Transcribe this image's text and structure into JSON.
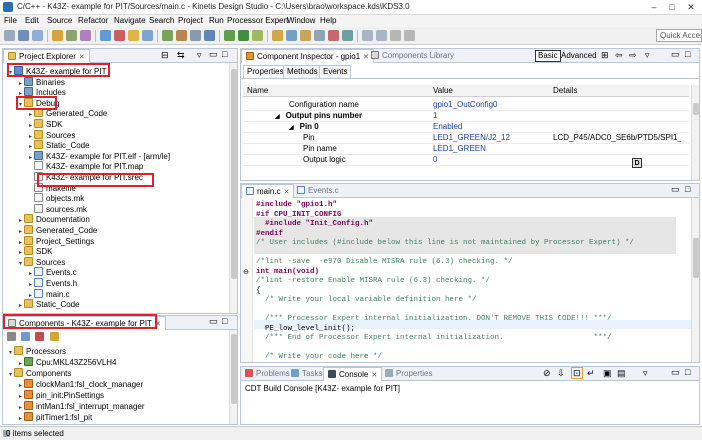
{
  "window": {
    "title": "C/C++ - K43Z- example for PIT/Sources/main.c - Kinetis Design Studio - C:\\Users\\brao\\workspace.kds\\KDS3.0",
    "buttons": [
      "–",
      "□",
      "✕"
    ]
  },
  "menu": [
    "File",
    "Edit",
    "Source",
    "Refactor",
    "Navigate",
    "Search",
    "Project",
    "Run",
    "Processor Expert",
    "Window",
    "Help"
  ],
  "toolbar": {
    "quick_access": "Quick Access"
  },
  "project_explorer": {
    "tab_label": "Project Explorer",
    "items": [
      {
        "label": "K43Z- example for PIT",
        "level": 0,
        "icon": "project",
        "arrow": "▾"
      },
      {
        "label": "Binaries",
        "level": 1,
        "icon": "bin",
        "arrow": "▸"
      },
      {
        "label": "Includes",
        "level": 1,
        "icon": "bin",
        "arrow": "▸"
      },
      {
        "label": "Debug",
        "level": 1,
        "icon": "folder",
        "arrow": "▾"
      },
      {
        "label": "Generated_Code",
        "level": 2,
        "icon": "folder",
        "arrow": "▸"
      },
      {
        "label": "SDK",
        "level": 2,
        "icon": "folder",
        "arrow": "▸"
      },
      {
        "label": "Sources",
        "level": 2,
        "icon": "folder",
        "arrow": "▸"
      },
      {
        "label": "Static_Code",
        "level": 2,
        "icon": "folder",
        "arrow": "▸"
      },
      {
        "label": "K43Z- example for PIT.elf - [arm/le]",
        "level": 2,
        "icon": "bin",
        "arrow": "▸"
      },
      {
        "label": "K43Z- example for PIT.map",
        "level": 2,
        "icon": "file",
        "arrow": ""
      },
      {
        "label": "K43Z- example for PIT.srec",
        "level": 2,
        "icon": "file",
        "arrow": ""
      },
      {
        "label": "makefile",
        "level": 2,
        "icon": "file",
        "arrow": ""
      },
      {
        "label": "objects.mk",
        "level": 2,
        "icon": "file",
        "arrow": ""
      },
      {
        "label": "sources.mk",
        "level": 2,
        "icon": "file",
        "arrow": ""
      },
      {
        "label": "Documentation",
        "level": 1,
        "icon": "folder",
        "arrow": "▸"
      },
      {
        "label": "Generated_Code",
        "level": 1,
        "icon": "folder",
        "arrow": "▸"
      },
      {
        "label": "Project_Settings",
        "level": 1,
        "icon": "folder",
        "arrow": "▸"
      },
      {
        "label": "SDK",
        "level": 1,
        "icon": "folder",
        "arrow": "▸"
      },
      {
        "label": "Sources",
        "level": 1,
        "icon": "folder",
        "arrow": "▾"
      },
      {
        "label": "Events.c",
        "level": 2,
        "icon": "cfile",
        "arrow": "▸"
      },
      {
        "label": "Events.h",
        "level": 2,
        "icon": "cfile",
        "arrow": "▸"
      },
      {
        "label": "main.c",
        "level": 2,
        "icon": "cfile",
        "arrow": "▸"
      },
      {
        "label": "Static_Code",
        "level": 1,
        "icon": "folder",
        "arrow": "▸"
      }
    ]
  },
  "components_view": {
    "tab_label": "Components - K43Z- example for PIT",
    "items": [
      {
        "label": "Processors",
        "level": 0,
        "icon": "folder",
        "arrow": "▾"
      },
      {
        "label": "Cpu:MKL43Z256VLH4",
        "level": 1,
        "icon": "cpu",
        "arrow": "▸"
      },
      {
        "label": "Components",
        "level": 0,
        "icon": "folder",
        "arrow": "▾"
      },
      {
        "label": "clockMan1:fsl_clock_manager",
        "level": 1,
        "icon": "bean",
        "arrow": "▸"
      },
      {
        "label": "pin_init:PinSettings",
        "level": 1,
        "icon": "bean",
        "arrow": "▸"
      },
      {
        "label": "intMan1:fsl_interrupt_manager",
        "level": 1,
        "icon": "bean",
        "arrow": "▸"
      },
      {
        "label": "pitTimer1:fsl_pit",
        "level": 1,
        "icon": "bean",
        "arrow": "▸"
      }
    ]
  },
  "inspector": {
    "tab_label": "Component Inspector - gpio1",
    "library_tab": "Components Library",
    "subtabs": [
      "Properties",
      "Methods",
      "Events"
    ],
    "mode_basic": "Basic",
    "mode_advanced": "Advanced",
    "columns": [
      "Name",
      "Value",
      "Details"
    ],
    "rows": [
      {
        "name": "Configuration name",
        "value": "gpio1_OutConfig0",
        "details": "",
        "indent": 3,
        "bold": false,
        "arrow": ""
      },
      {
        "name": "Output pins number",
        "value": "1",
        "details": "",
        "indent": 2,
        "bold": true,
        "arrow": "◢"
      },
      {
        "name": "Pin 0",
        "value": "Enabled",
        "details": "",
        "indent": 3,
        "bold": true,
        "arrow": "◢"
      },
      {
        "name": "Pin",
        "value": "LED1_GREEN/J2_12",
        "details": "LCD_P45/ADC0_SE6b/PTD5/SPI1_S...",
        "indent": 4,
        "bold": false,
        "arrow": ""
      },
      {
        "name": "Pin name",
        "value": "LED1_GREEN",
        "details": "",
        "indent": 4,
        "bold": false,
        "arrow": ""
      },
      {
        "name": "Output logic",
        "value": "0",
        "details": "",
        "indent": 4,
        "bold": false,
        "arrow": ""
      }
    ],
    "dropdown_marker": "D"
  },
  "editor": {
    "tabs": [
      "main.c",
      "Events.c"
    ],
    "lines": [
      {
        "text": "#include \"gpio1.h\"",
        "kind": "pp"
      },
      {
        "text": "#if CPU_INIT_CONFIG",
        "kind": "pp"
      },
      {
        "text": "  #include \"Init_Config.h\"",
        "kind": "pp"
      },
      {
        "text": "#endif",
        "kind": "pp"
      },
      {
        "text": "/* User includes (#include below this line is not maintained by Processor Expert) */",
        "kind": "cmt"
      },
      {
        "text": "",
        "kind": ""
      },
      {
        "text": "/*lint -save  -e970 Disable MISRA rule (6.3) checking. */",
        "kind": "cmt"
      },
      {
        "text": "int main(void)",
        "kind": "kw"
      },
      {
        "text": "/*lint -restore Enable MISRA rule (6.3) checking. */",
        "kind": "cmt"
      },
      {
        "text": "{",
        "kind": ""
      },
      {
        "text": "  /* Write your local variable definition here */",
        "kind": "cmt"
      },
      {
        "text": "",
        "kind": ""
      },
      {
        "text": "  /*** Processor Expert internal initialization. DON'T REMOVE THIS CODE!!! ***/",
        "kind": "cmt"
      },
      {
        "text": "  PE_low_level_init();",
        "kind": ""
      },
      {
        "text": "  /*** End of Processor Expert internal initialization.                    ***/",
        "kind": "cmt"
      },
      {
        "text": "",
        "kind": ""
      },
      {
        "text": "  /* Write your code here */",
        "kind": "cmt"
      }
    ]
  },
  "console": {
    "tabs": [
      "Problems",
      "Tasks",
      "Console",
      "Properties"
    ],
    "text": "CDT Build Console [K43Z- example for PIT]"
  },
  "status": {
    "text": "0 items selected"
  }
}
